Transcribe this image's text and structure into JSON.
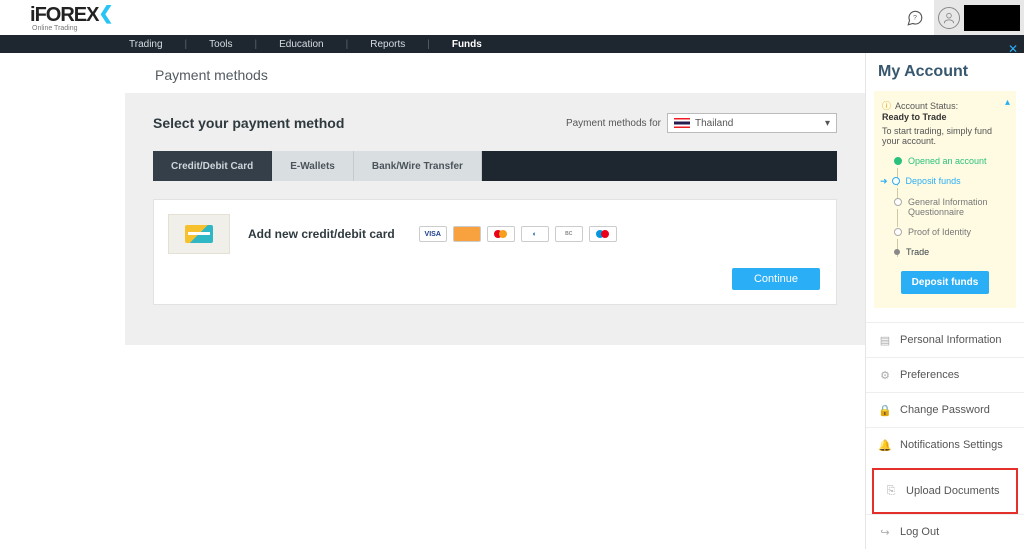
{
  "brand": {
    "name": "iFOREX",
    "tagline": "Online Trading"
  },
  "nav": {
    "items": [
      "Trading",
      "Tools",
      "Education",
      "Reports",
      "Funds"
    ],
    "active": "Funds"
  },
  "page": {
    "title": "Payment methods"
  },
  "panel": {
    "heading": "Select your payment method",
    "pm_for_label": "Payment methods for",
    "country": "Thailand"
  },
  "tabs": {
    "items": [
      "Credit/Debit Card",
      "E-Wallets",
      "Bank/Wire Transfer"
    ],
    "active": 0
  },
  "method": {
    "title": "Add new credit/debit card",
    "brands": [
      "VISA",
      "JCB",
      "MC",
      "DINERS",
      "BC",
      "MAESTRO"
    ],
    "continue": "Continue"
  },
  "sidebar": {
    "title": "My Account",
    "status_label": "Account Status:",
    "status_value": "Ready to Trade",
    "status_desc": "To start trading, simply fund your account.",
    "steps": [
      {
        "label": "Opened an account",
        "state": "done"
      },
      {
        "label": "Deposit funds",
        "state": "current"
      },
      {
        "label": "General Information Questionnaire",
        "state": "future"
      },
      {
        "label": "Proof of Identity",
        "state": "future"
      },
      {
        "label": "Trade",
        "state": "trade"
      }
    ],
    "deposit_btn": "Deposit funds",
    "menu": [
      "Personal Information",
      "Preferences",
      "Change Password",
      "Notifications Settings",
      "Upload Documents",
      "Log Out"
    ],
    "highlight_index": 4
  }
}
